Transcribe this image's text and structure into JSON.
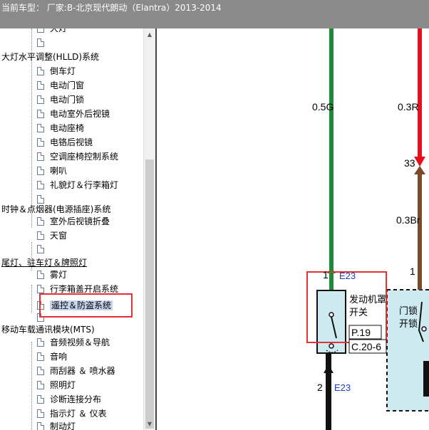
{
  "header": {
    "title": "当前车型： 厂家:B-北京现代朗动（Elantra）2013-2014"
  },
  "tree": {
    "items": [
      {
        "level": 1,
        "label": "大灯"
      },
      {
        "level": 1,
        "label": ""
      },
      {
        "level": 0,
        "label": "大灯水平调整(HLLD)系统"
      },
      {
        "level": 1,
        "label": "倒车灯"
      },
      {
        "level": 1,
        "label": "电动门窗"
      },
      {
        "level": 1,
        "label": "电动门锁"
      },
      {
        "level": 1,
        "label": "电动室外后视镜"
      },
      {
        "level": 1,
        "label": "电动座椅"
      },
      {
        "level": 1,
        "label": "电铬后视镜"
      },
      {
        "level": 1,
        "label": "空调座椅控制系统"
      },
      {
        "level": 1,
        "label": "喇叭"
      },
      {
        "level": 1,
        "label": "礼貌灯＆行李箱灯"
      },
      {
        "level": 1,
        "label": ""
      },
      {
        "level": 0,
        "label": "时钟＆点烟器(电源插座)系统"
      },
      {
        "level": 1,
        "label": "室外后视镜折叠"
      },
      {
        "level": 1,
        "label": "天窗"
      },
      {
        "level": 1,
        "label": ""
      },
      {
        "level": 0,
        "label": "尾灯、驻车灯＆牌照灯"
      },
      {
        "level": 1,
        "label": "雾灯"
      },
      {
        "level": 1,
        "label": "行李箱盖开启系统"
      },
      {
        "level": 1,
        "label": "遥控＆防盗系统"
      },
      {
        "level": 1,
        "label": ""
      },
      {
        "level": 0,
        "label": "移动车载通讯模块(MTS)"
      },
      {
        "level": 1,
        "label": "音频视频＆导航"
      },
      {
        "level": 1,
        "label": "音响"
      },
      {
        "level": 1,
        "label": "雨刮器 ＆ 喷水器"
      },
      {
        "level": 1,
        "label": "照明灯"
      },
      {
        "level": 1,
        "label": "诊断连接分布"
      },
      {
        "level": 1,
        "label": "指示灯 ＆ 仪表"
      },
      {
        "level": 1,
        "label": "制动灯"
      }
    ],
    "selected_index": 20
  },
  "scrollbar": {
    "up_icon": "arrow-up-icon",
    "down_icon": "arrow-down-icon"
  },
  "diagram": {
    "wires": [
      {
        "label": "0.5G",
        "color": "#1e8a3a"
      },
      {
        "label": "0.3R",
        "color": "#e6101d"
      },
      {
        "label": "0.3Br",
        "color": "#7a4a2a"
      },
      {
        "label": "",
        "color": "#111111"
      }
    ],
    "pin_33": "33",
    "pin_1_right": "1",
    "connector_top": {
      "pin": "1",
      "name": "E23"
    },
    "connector_bottom": {
      "pin": "2",
      "name": "E23"
    },
    "hood_switch": {
      "line1": "发动机罩",
      "line2": "开关",
      "page": "P.19",
      "ref": "C.20-6"
    },
    "door_switch": {
      "line1": "门锁",
      "line2": "开锁"
    },
    "colors": {
      "switch_fill": "#cdeaf0",
      "highlight": "#e3313a",
      "connector_text": "#1b3fbf"
    }
  }
}
